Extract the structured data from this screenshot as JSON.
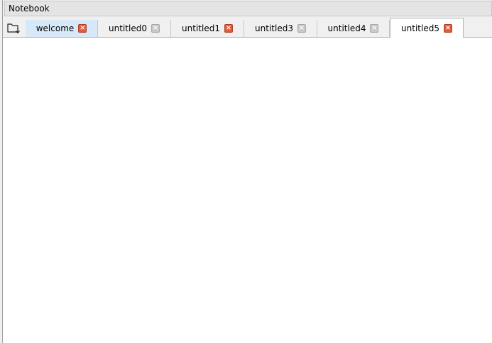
{
  "window": {
    "title": "Notebook"
  },
  "toolbar": {
    "open_icon": "folder-open-icon"
  },
  "tabs": [
    {
      "label": "welcome",
      "close_style": "red",
      "state": "hover"
    },
    {
      "label": "untitled0",
      "close_style": "grey",
      "state": "normal"
    },
    {
      "label": "untitled1",
      "close_style": "red",
      "state": "normal"
    },
    {
      "label": "untitled3",
      "close_style": "grey",
      "state": "normal"
    },
    {
      "label": "untitled4",
      "close_style": "grey",
      "state": "normal"
    },
    {
      "label": "untitled5",
      "close_style": "red",
      "state": "active"
    }
  ],
  "close_glyph": "×",
  "colors": {
    "close_red": "#e0593a",
    "close_grey": "#c8c8c8",
    "hover_tab": "#d7e8f8",
    "active_tab": "#ffffff"
  }
}
